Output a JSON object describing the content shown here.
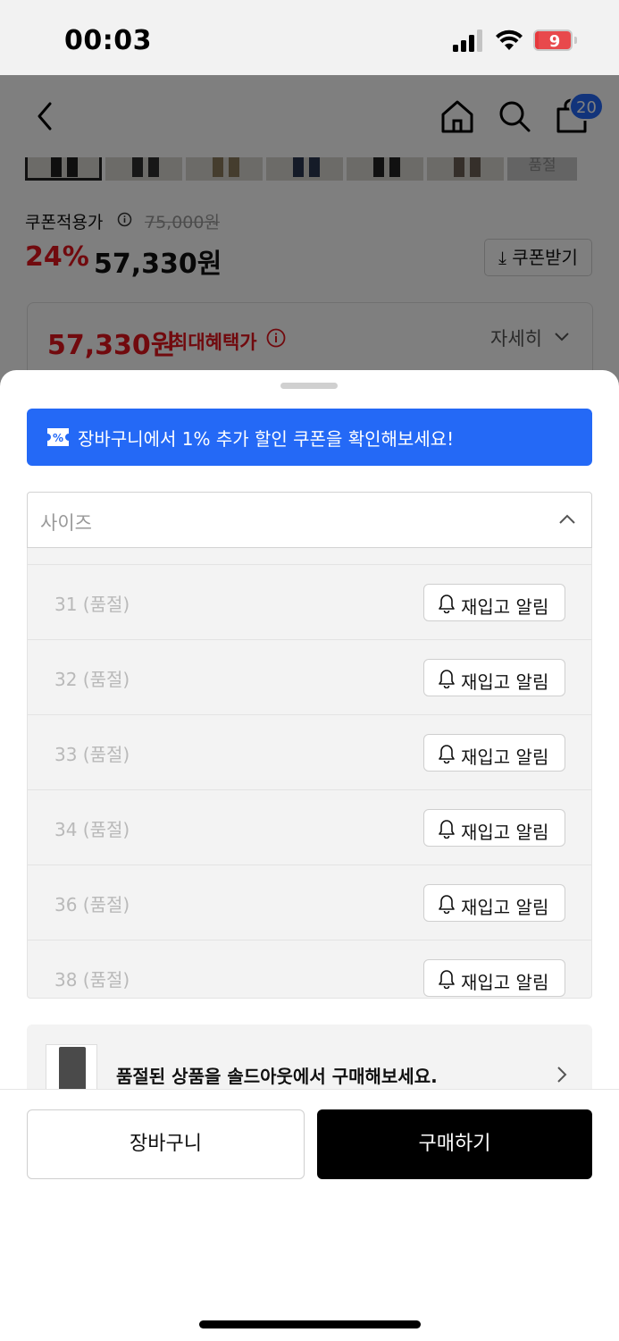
{
  "status_bar": {
    "time": "00:03",
    "battery_level": "9"
  },
  "nav": {
    "back_icon": "chevron-left-icon",
    "home_icon": "home-icon",
    "search_icon": "search-icon",
    "cart_icon": "shopping-bag-icon",
    "cart_count": "20"
  },
  "thumbnails": {
    "soldout_label": "품절"
  },
  "price": {
    "label": "쿠폰적용가",
    "original": "75,000원",
    "discount": "24%",
    "final": "57,330원",
    "coupon_button": "⤓ 쿠폰받기"
  },
  "benefit": {
    "price": "57,330원",
    "label": "최대혜택가",
    "detail": "자세히"
  },
  "sheet": {
    "promo_text": "장바구니에서 1% 추가 할인 쿠폰을 확인해보세요!",
    "size_label": "사이즈",
    "sizes": [
      {
        "name": "31 (품절)",
        "button": "재입고 알림"
      },
      {
        "name": "32 (품절)",
        "button": "재입고 알림"
      },
      {
        "name": "33 (품절)",
        "button": "재입고 알림"
      },
      {
        "name": "34 (품절)",
        "button": "재입고 알림"
      },
      {
        "name": "36 (품절)",
        "button": "재입고 알림"
      },
      {
        "name": "38 (품절)",
        "button": "재입고 알림"
      }
    ],
    "soldout_banner_text": "품절된 상품을 솔드아웃에서 구매해보세요.",
    "cart_button": "장바구니",
    "buy_button": "구매하기"
  },
  "colors": {
    "accent_blue": "#2469f6",
    "discount_red": "#e2141c",
    "buy_button_bg": "#000000"
  }
}
